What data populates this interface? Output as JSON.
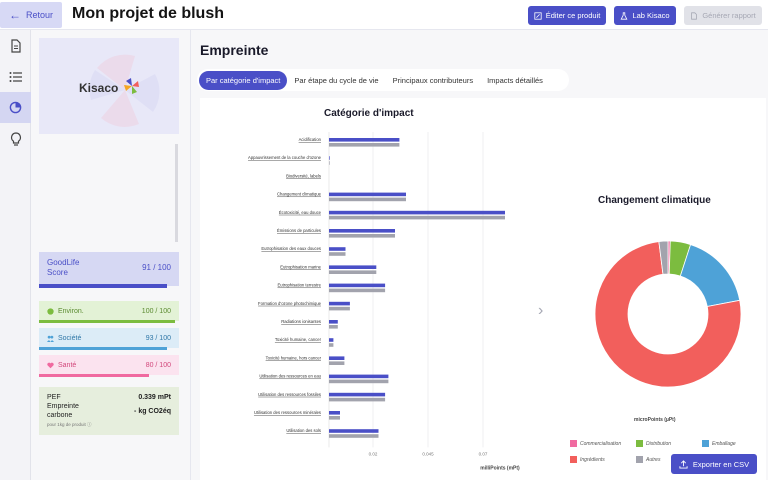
{
  "header": {
    "back_label": "Retour",
    "title": "Mon projet de blush",
    "edit_label": "Éditer ce produit",
    "lab_label": "Lab Kisaco",
    "report_label": "Générer rapport"
  },
  "rail": {
    "icons": [
      "document-icon",
      "list-icon",
      "pie-chart-icon",
      "lightbulb-icon"
    ],
    "active_index": 2
  },
  "side": {
    "logo_text": "Kisaco",
    "goodlife": {
      "title": "GoodLife Score",
      "score": "91 / 100",
      "fraction": 0.91
    },
    "categories": [
      {
        "label": "Environ.",
        "score": "100 / 100",
        "fraction": 1.0
      },
      {
        "label": "Société",
        "score": "93 / 100",
        "fraction": 0.93
      },
      {
        "label": "Santé",
        "score": "80 / 100",
        "fraction": 0.8
      }
    ],
    "pef": {
      "pef_label": "PEF",
      "pef_value": "0.339 mPt",
      "carbon_label": "Empreinte carbone",
      "carbon_value": "- kg CO2éq",
      "note": "pour 1kg de produit"
    }
  },
  "main": {
    "section_title": "Empreinte",
    "tabs": [
      {
        "label": "Par catégorie d'impact",
        "active": true
      },
      {
        "label": "Par étape du cycle de vie",
        "active": false
      },
      {
        "label": "Principaux contributeurs",
        "active": false
      },
      {
        "label": "Impacts détaillés",
        "active": false
      }
    ],
    "export_label": "Exporter en CSV"
  },
  "chart_data": [
    {
      "type": "bar",
      "orientation": "horizontal",
      "title": "Catégorie d'impact",
      "xlabel": "milliPoints (mPt)",
      "ylabel": "",
      "xlim": [
        0,
        0.08
      ],
      "xticks": [
        "0.02",
        "0.045",
        "0.07"
      ],
      "categories": [
        "Acidification",
        "Appauvrissement de la couche d'ozone",
        "Biodiversité, labels",
        "Changement climatique",
        "Écotoxicité, eau douce",
        "Émissions de particules",
        "Eutrophisation des eaux douces",
        "Eutrophisation marine",
        "Eutrophisation terrestre",
        "Formation d'ozone photochimique",
        "Radiations ionisantes",
        "Toxicité humaine, cancer",
        "Toxicité humaine, hors cancer",
        "Utilisation des ressources en eau",
        "Utilisation des ressources fossiles",
        "Utilisation des ressources minérales",
        "Utilisation des sols"
      ],
      "series": [
        {
          "color": "#4a4fc7",
          "values": [
            0.032,
            0.0003,
            0,
            0.035,
            0.08,
            0.03,
            0.0075,
            0.0215,
            0.0255,
            0.0095,
            0.004,
            0.002,
            0.007,
            0.027,
            0.0255,
            0.005,
            0.0225
          ]
        },
        {
          "color": "#a2a3ad",
          "values": [
            0.032,
            0.0003,
            0,
            0.035,
            0.08,
            0.03,
            0.0075,
            0.0215,
            0.0255,
            0.0095,
            0.004,
            0.002,
            0.007,
            0.027,
            0.0255,
            0.005,
            0.0225
          ]
        }
      ],
      "grid": true
    },
    {
      "type": "pie",
      "subtype": "donut",
      "title": "Changement climatique",
      "unit": "microPoints (µPt)",
      "slices": [
        {
          "label": "Commercialisation",
          "value": 0.5,
          "color": "#f06aa0"
        },
        {
          "label": "Distribution",
          "value": 4.5,
          "color": "#7cbc3f"
        },
        {
          "label": "Emballage",
          "value": 17,
          "color": "#4ea2d7"
        },
        {
          "label": "Ingrédients",
          "value": 76,
          "color": "#f25f5c"
        },
        {
          "label": "Autres",
          "value": 2,
          "color": "#a2a3ad"
        }
      ],
      "legend": "bottom"
    }
  ]
}
